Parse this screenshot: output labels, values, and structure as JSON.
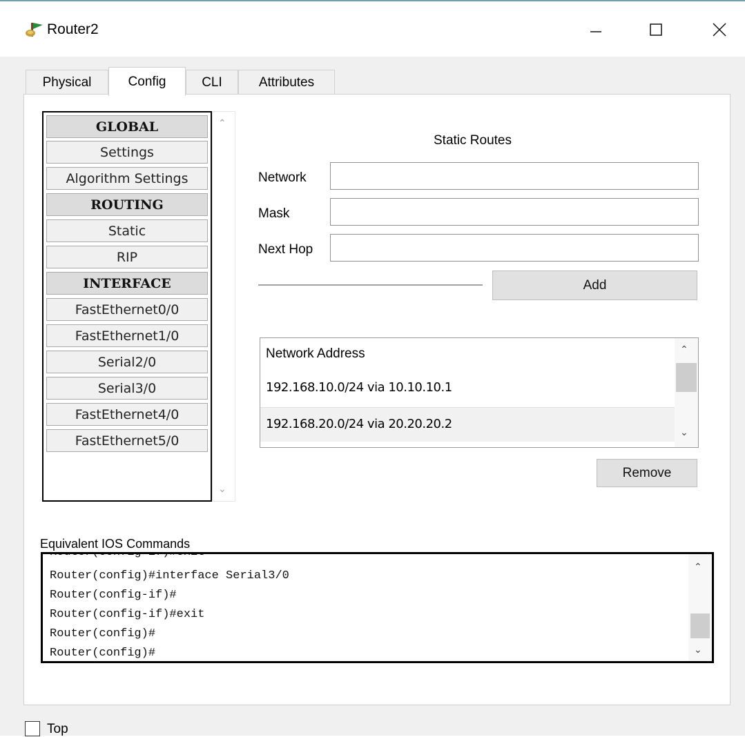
{
  "window": {
    "title": "Router2"
  },
  "tabs": [
    {
      "label": "Physical"
    },
    {
      "label": "Config"
    },
    {
      "label": "CLI"
    },
    {
      "label": "Attributes"
    }
  ],
  "active_tab": "Config",
  "nav": {
    "items": [
      {
        "label": "GLOBAL",
        "header": true
      },
      {
        "label": "Settings"
      },
      {
        "label": "Algorithm Settings"
      },
      {
        "label": "ROUTING",
        "header": true
      },
      {
        "label": "Static"
      },
      {
        "label": "RIP"
      },
      {
        "label": "INTERFACE",
        "header": true
      },
      {
        "label": "FastEthernet0/0"
      },
      {
        "label": "FastEthernet1/0"
      },
      {
        "label": "Serial2/0"
      },
      {
        "label": "Serial3/0"
      },
      {
        "label": "FastEthernet4/0"
      },
      {
        "label": "FastEthernet5/0"
      }
    ]
  },
  "static_routes": {
    "title": "Static Routes",
    "network_label": "Network",
    "network_value": "",
    "mask_label": "Mask",
    "mask_value": "",
    "next_hop_label": "Next Hop",
    "next_hop_value": "",
    "add_label": "Add",
    "list_header": "Network Address",
    "routes": [
      "192.168.10.0/24 via 10.10.10.1",
      "192.168.20.0/24 via 20.20.20.2"
    ],
    "remove_label": "Remove"
  },
  "ios": {
    "label": "Equivalent IOS Commands",
    "lines": [
      "Router(config-if)#exit",
      "Router(config)#interface Serial3/0",
      "Router(config-if)#",
      "Router(config-if)#exit",
      "Router(config)#",
      "Router(config)#"
    ]
  },
  "footer": {
    "top_label": "Top",
    "top_checked": false
  }
}
